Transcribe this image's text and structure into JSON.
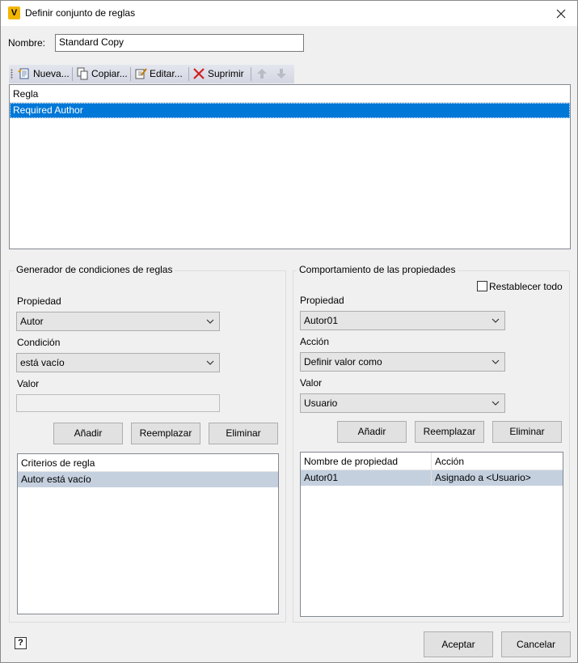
{
  "window": {
    "title": "Definir conjunto de reglas",
    "app_icon_letter": "V"
  },
  "name_field": {
    "label": "Nombre:",
    "value": "Standard Copy"
  },
  "toolbar": {
    "new_label": "Nueva...",
    "copy_label": "Copiar...",
    "edit_label": "Editar...",
    "delete_label": "Suprimir",
    "up_icon": "arrow-up-icon",
    "down_icon": "arrow-down-icon"
  },
  "rules_list": {
    "header": "Regla",
    "items": [
      "Required Author"
    ]
  },
  "condition_builder": {
    "title": "Generador de condiciones de reglas",
    "property_label": "Propiedad",
    "property_value": "Autor",
    "condition_label": "Condición",
    "condition_value": "está vacío",
    "value_label": "Valor",
    "value_value": "",
    "add_label": "Añadir",
    "replace_label": "Reemplazar",
    "remove_label": "Eliminar",
    "criteria_header": "Criterios de regla",
    "criteria_items": [
      "Autor está vacío"
    ]
  },
  "property_behavior": {
    "title": "Comportamiento de las propiedades",
    "reset_all_label": "Restablecer todo",
    "reset_all_checked": false,
    "property_label": "Propiedad",
    "property_value": "Autor01",
    "action_label": "Acción",
    "action_value": "Definir valor como",
    "value_label": "Valor",
    "value_value": "Usuario",
    "add_label": "Añadir",
    "replace_label": "Reemplazar",
    "remove_label": "Eliminar",
    "columns": [
      "Nombre de propiedad",
      "Acción"
    ],
    "rows": [
      {
        "name": "Autor01",
        "action": "Asignado a <Usuario>"
      }
    ]
  },
  "footer": {
    "help_icon": "help-icon",
    "ok_label": "Aceptar",
    "cancel_label": "Cancelar"
  },
  "colors": {
    "selection_blue": "#0078d7",
    "selection_gray": "#c5d0df",
    "app_icon": "#f2b600"
  }
}
